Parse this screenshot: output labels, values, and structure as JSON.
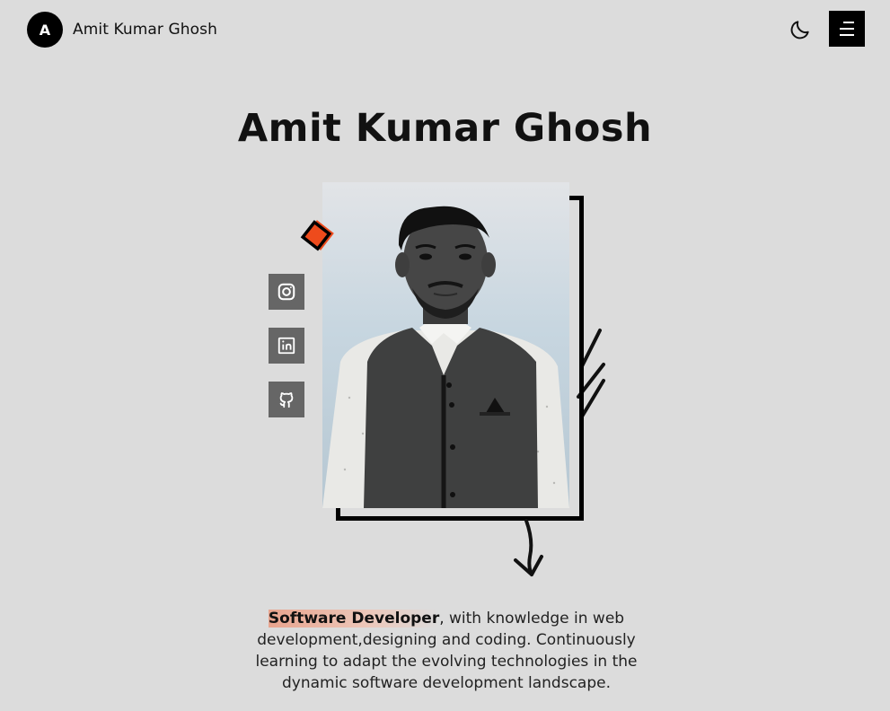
{
  "header": {
    "avatar_initial": "A",
    "brand_name": "Amit Kumar Ghosh",
    "theme_toggle_icon": "moon-icon",
    "menu_icon": "hamburger-menu-icon"
  },
  "hero": {
    "title": "Amit Kumar Ghosh",
    "photo_alt": "Portrait of Amit Kumar Ghosh"
  },
  "social_links": [
    {
      "name": "Instagram",
      "icon": "instagram-icon"
    },
    {
      "name": "LinkedIn",
      "icon": "linkedin-icon"
    },
    {
      "name": "GitHub",
      "icon": "github-icon"
    }
  ],
  "bio": {
    "highlight": "Software Developer",
    "text": ", with knowledge in web development,designing and coding. Continuously learning to adapt the evolving technologies in the dynamic software development landscape."
  },
  "colors": {
    "background": "#dcdcdc",
    "accent": "#ee4b1c",
    "dark": "#000000",
    "social_button": "#666666",
    "highlight": "#e8a48e"
  }
}
